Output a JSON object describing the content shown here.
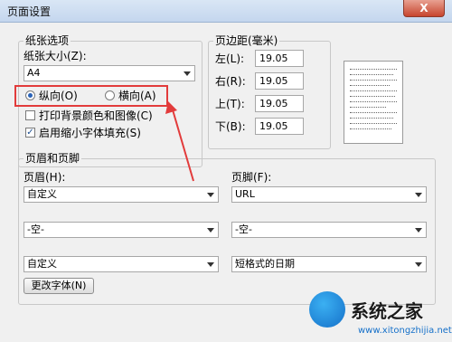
{
  "window": {
    "title": "页面设置",
    "close_label": "X"
  },
  "paper": {
    "group_label": "纸张选项",
    "size_label": "纸张大小(Z):",
    "size_value": "A4",
    "orientation": {
      "portrait_label": "纵向(O)",
      "landscape_label": "横向(A)",
      "selected": "portrait"
    },
    "print_bg_label": "打印背景颜色和图像(C)",
    "print_bg_checked": false,
    "shrink_label": "启用缩小字体填充(S)",
    "shrink_checked": true
  },
  "margins": {
    "group_label": "页边距(毫米)",
    "left_label": "左(L):",
    "left_value": "19.05",
    "right_label": "右(R):",
    "right_value": "19.05",
    "top_label": "上(T):",
    "top_value": "19.05",
    "bottom_label": "下(B):",
    "bottom_value": "19.05"
  },
  "header_footer": {
    "group_label": "页眉和页脚",
    "header_label": "页眉(H):",
    "footer_label": "页脚(F):",
    "header": [
      "自定义",
      "-空-",
      "自定义"
    ],
    "footer": [
      "URL",
      "-空-",
      "短格式的日期"
    ],
    "change_font_label": "更改字体(N)"
  },
  "watermark": {
    "text": "系统之家",
    "url": "www.xitongzhijia.net"
  },
  "colors": {
    "highlight": "#e23b3b",
    "arrow": "#e23b3b"
  }
}
